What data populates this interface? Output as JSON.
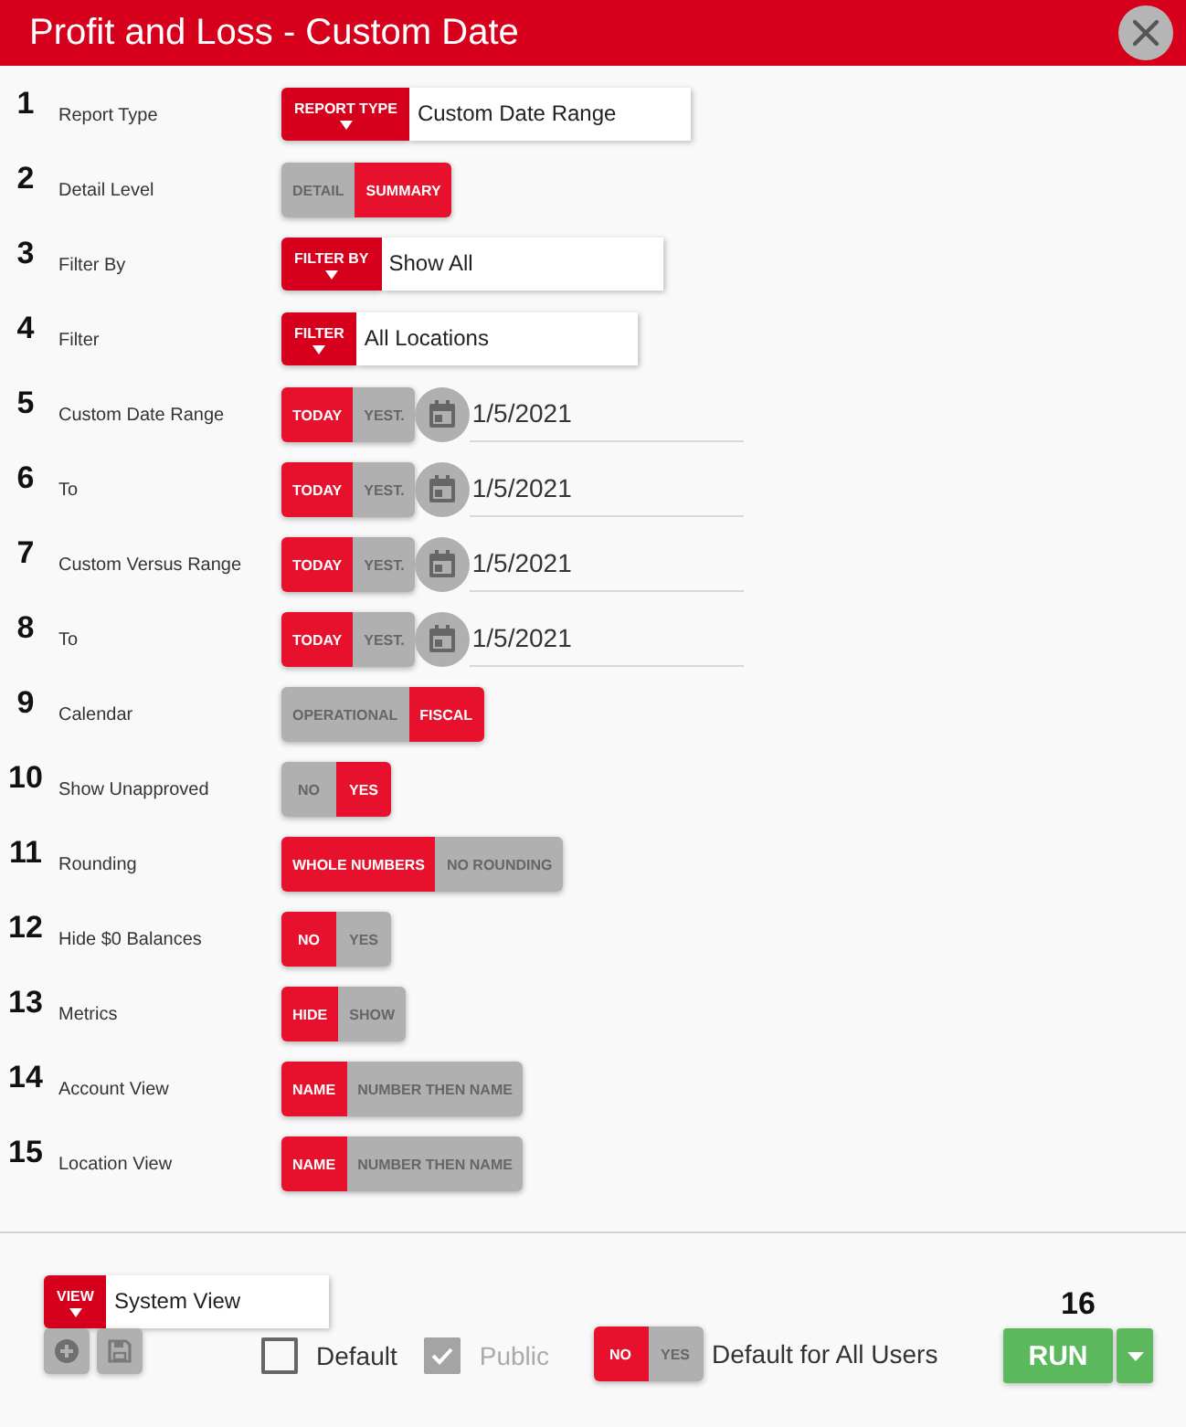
{
  "window": {
    "title": "Profit and Loss - Custom Date"
  },
  "settings": [
    {
      "number": "1",
      "label": "Report Type",
      "kind": "select",
      "button": "REPORT TYPE",
      "value": "Custom Date Range"
    },
    {
      "number": "2",
      "label": "Detail Level",
      "kind": "toggle",
      "options": [
        {
          "label": "DETAIL",
          "selected": false
        },
        {
          "label": "SUMMARY",
          "selected": true
        }
      ]
    },
    {
      "number": "3",
      "label": "Filter By",
      "kind": "select",
      "button": "FILTER BY",
      "value": "Show All"
    },
    {
      "number": "4",
      "label": "Filter",
      "kind": "select",
      "button": "FILTER",
      "value": "All Locations"
    },
    {
      "number": "5",
      "label": "Custom Date Range",
      "kind": "date",
      "options": [
        {
          "label": "TODAY",
          "selected": true
        },
        {
          "label": "YEST.",
          "selected": false
        }
      ],
      "value": "1/5/2021"
    },
    {
      "number": "6",
      "label": "To",
      "kind": "date",
      "options": [
        {
          "label": "TODAY",
          "selected": true
        },
        {
          "label": "YEST.",
          "selected": false
        }
      ],
      "value": "1/5/2021"
    },
    {
      "number": "7",
      "label": "Custom Versus Range",
      "kind": "date",
      "options": [
        {
          "label": "TODAY",
          "selected": true
        },
        {
          "label": "YEST.",
          "selected": false
        }
      ],
      "value": "1/5/2021"
    },
    {
      "number": "8",
      "label": "To",
      "kind": "date",
      "options": [
        {
          "label": "TODAY",
          "selected": true
        },
        {
          "label": "YEST.",
          "selected": false
        }
      ],
      "value": "1/5/2021"
    },
    {
      "number": "9",
      "label": "Calendar",
      "kind": "toggle",
      "options": [
        {
          "label": "OPERATIONAL",
          "selected": false
        },
        {
          "label": "FISCAL",
          "selected": true
        }
      ]
    },
    {
      "number": "10",
      "label": "Show Unapproved",
      "kind": "toggle",
      "options": [
        {
          "label": "NO",
          "selected": false
        },
        {
          "label": "YES",
          "selected": true
        }
      ]
    },
    {
      "number": "11",
      "label": "Rounding",
      "kind": "toggle",
      "options": [
        {
          "label": "WHOLE NUMBERS",
          "selected": true
        },
        {
          "label": "NO ROUNDING",
          "selected": false
        }
      ]
    },
    {
      "number": "12",
      "label": "Hide $0 Balances",
      "kind": "toggle",
      "options": [
        {
          "label": "NO",
          "selected": true
        },
        {
          "label": "YES",
          "selected": false
        }
      ]
    },
    {
      "number": "13",
      "label": "Metrics",
      "kind": "toggle",
      "options": [
        {
          "label": "HIDE",
          "selected": true
        },
        {
          "label": "SHOW",
          "selected": false
        }
      ]
    },
    {
      "number": "14",
      "label": "Account View",
      "kind": "toggle",
      "options": [
        {
          "label": "NAME",
          "selected": true
        },
        {
          "label": "NUMBER THEN NAME",
          "selected": false
        }
      ]
    },
    {
      "number": "15",
      "label": "Location View",
      "kind": "toggle",
      "options": [
        {
          "label": "NAME",
          "selected": true
        },
        {
          "label": "NUMBER THEN NAME",
          "selected": false
        }
      ]
    }
  ],
  "footer": {
    "view": {
      "button": "VIEW",
      "value": "System View"
    },
    "checkboxes": [
      {
        "label": "Default",
        "checked": false,
        "disabled": false
      },
      {
        "label": "Public",
        "checked": true,
        "disabled": true
      }
    ],
    "default_for_all_users": {
      "options": [
        {
          "label": "NO",
          "selected": true
        },
        {
          "label": "YES",
          "selected": false
        }
      ],
      "label": "Default for All Users"
    },
    "run": {
      "number": "16",
      "label": "RUN"
    }
  }
}
